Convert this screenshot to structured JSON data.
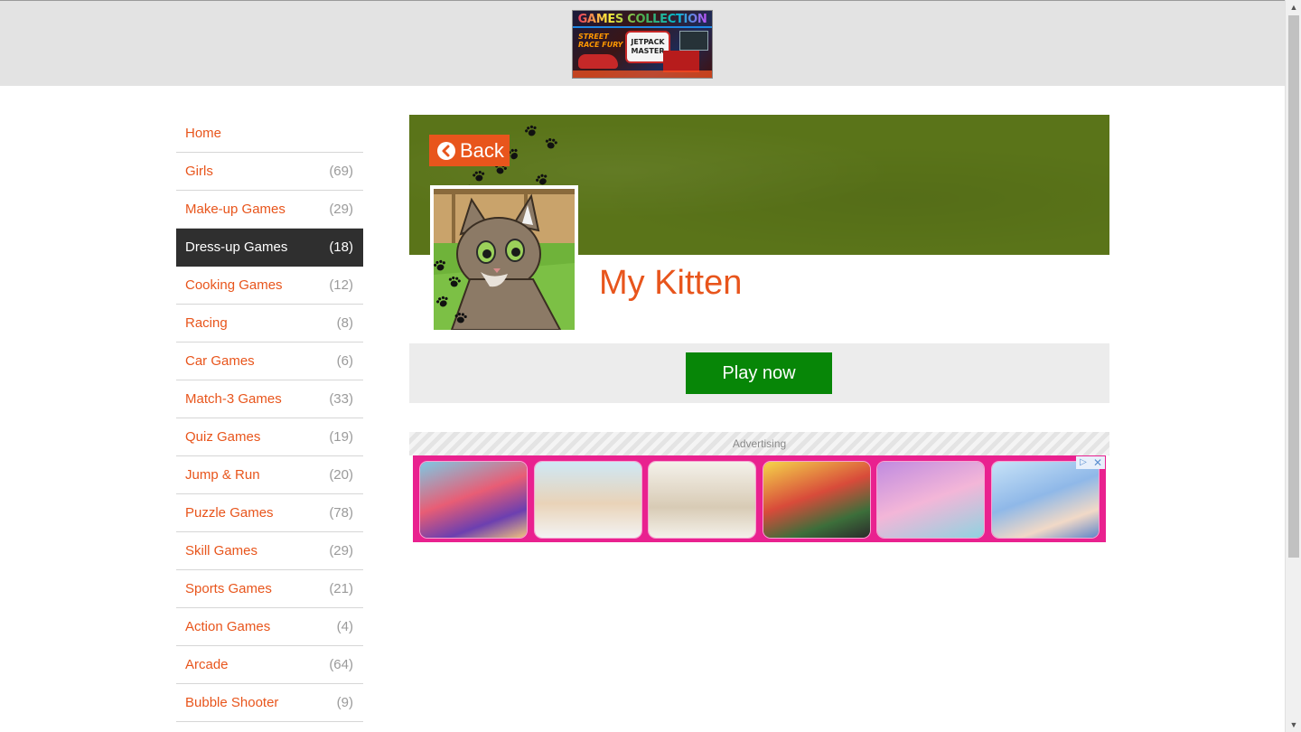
{
  "header": {
    "logo_text": "GAMES COLLECTION",
    "logo_sub": "JETPACK MASTER",
    "logo_side": "STREET RACE FURY"
  },
  "sidebar": {
    "items": [
      {
        "label": "Home",
        "count": ""
      },
      {
        "label": "Girls",
        "count": "(69)"
      },
      {
        "label": "Make-up Games",
        "count": "(29)"
      },
      {
        "label": "Dress-up Games",
        "count": "(18)",
        "active": true
      },
      {
        "label": "Cooking Games",
        "count": "(12)"
      },
      {
        "label": "Racing",
        "count": "(8)"
      },
      {
        "label": "Car Games",
        "count": "(6)"
      },
      {
        "label": "Match-3 Games",
        "count": "(33)"
      },
      {
        "label": "Quiz Games",
        "count": "(19)"
      },
      {
        "label": "Jump & Run",
        "count": "(20)"
      },
      {
        "label": "Puzzle Games",
        "count": "(78)"
      },
      {
        "label": "Skill Games",
        "count": "(29)"
      },
      {
        "label": "Sports Games",
        "count": "(21)"
      },
      {
        "label": "Action Games",
        "count": "(4)"
      },
      {
        "label": "Arcade",
        "count": "(64)"
      },
      {
        "label": "Bubble Shooter",
        "count": "(9)"
      }
    ]
  },
  "game": {
    "back_label": "Back",
    "title": "My Kitten",
    "play_label": "Play now"
  },
  "ad": {
    "label": "Advertising",
    "ad_choices_icon": "▷",
    "close_icon": "✕",
    "tiles": [
      "face-paint-girl",
      "injured-leg",
      "sewing-mannequin",
      "adventure-kids",
      "pony",
      "ice-princess"
    ]
  },
  "colors": {
    "accent": "#e8551c",
    "active_nav": "#2f2f2f",
    "banner": "#5a7419",
    "play": "#078607",
    "ad_bg": "#e9218f"
  }
}
